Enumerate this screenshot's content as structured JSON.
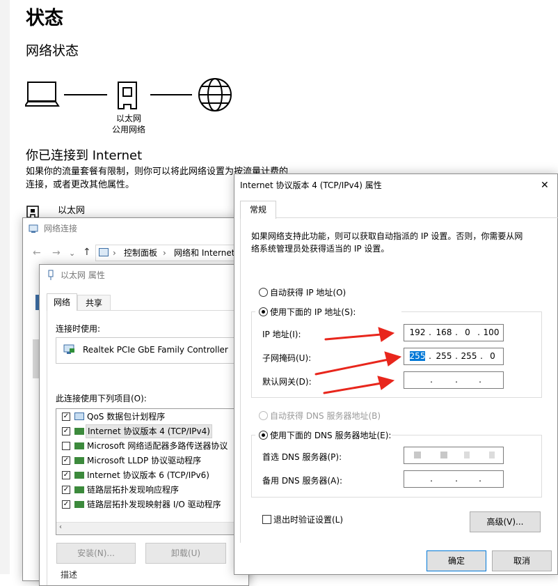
{
  "settings": {
    "page_title": "状态",
    "section_title": "网络状态",
    "adapter_label_line1": "以太网",
    "adapter_label_line2": "公用网络",
    "connected_title": "你已连接到 Internet",
    "desc_line1": "如果你的流量套餐有限制，则你可以将此网络设置为按流量计费的",
    "desc_line2": "连接，或者更改其他属性。",
    "ethernet_item": "以太网"
  },
  "net_connections": {
    "title": "网络连接",
    "breadcrumb": [
      "控制面板",
      "网络和 Internet"
    ]
  },
  "eth_props": {
    "title": "以太网 属性",
    "tabs": [
      "网络",
      "共享"
    ],
    "connect_using_label": "连接时使用:",
    "adapter_name": "Realtek PCIe GbE Family Controller",
    "items_label": "此连接使用下列项目(O):",
    "items": [
      {
        "label": "QoS 数据包计划程序",
        "checked": true
      },
      {
        "label": "Internet 协议版本 4 (TCP/IPv4)",
        "checked": true
      },
      {
        "label": "Microsoft 网络适配器多路传送器协议",
        "checked": false
      },
      {
        "label": "Microsoft LLDP 协议驱动程序",
        "checked": true
      },
      {
        "label": "Internet 协议版本 6 (TCP/IPv6)",
        "checked": true
      },
      {
        "label": "链路层拓扑发现响应程序",
        "checked": true
      },
      {
        "label": "链路层拓扑发现映射器 I/O 驱动程序",
        "checked": true
      }
    ],
    "install_button": "安装(N)...",
    "uninstall_button": "卸载(U)",
    "description_label": "描述"
  },
  "ipv4": {
    "title": "Internet 协议版本 4 (TCP/IPv4) 属性",
    "tab": "常规",
    "info_line1": "如果网络支持此功能，则可以获取自动指派的 IP 设置。否则，你需要从网",
    "info_line2": "络系统管理员处获得适当的 IP 设置。",
    "auto_ip_label": "自动获得 IP 地址(O)",
    "manual_ip_label": "使用下面的 IP 地址(S):",
    "ip_label": "IP 地址(I):",
    "ip_value": [
      "192",
      "168",
      "0",
      "100"
    ],
    "subnet_label": "子网掩码(U):",
    "subnet_value": [
      "255",
      "255",
      "255",
      "0"
    ],
    "gateway_label": "默认网关(D):",
    "auto_dns_label": "自动获得 DNS 服务器地址(B)",
    "manual_dns_label": "使用下面的 DNS 服务器地址(E):",
    "pref_dns_label": "首选 DNS 服务器(P):",
    "alt_dns_label": "备用 DNS 服务器(A):",
    "validate_label": "退出时验证设置(L)",
    "advanced_button": "高级(V)...",
    "ok_button": "确定",
    "cancel_button": "取消",
    "close_glyph": "✕"
  },
  "colors": {
    "arrow": "#e8261c",
    "accent": "#0078d7",
    "selection": "#0078d7"
  }
}
